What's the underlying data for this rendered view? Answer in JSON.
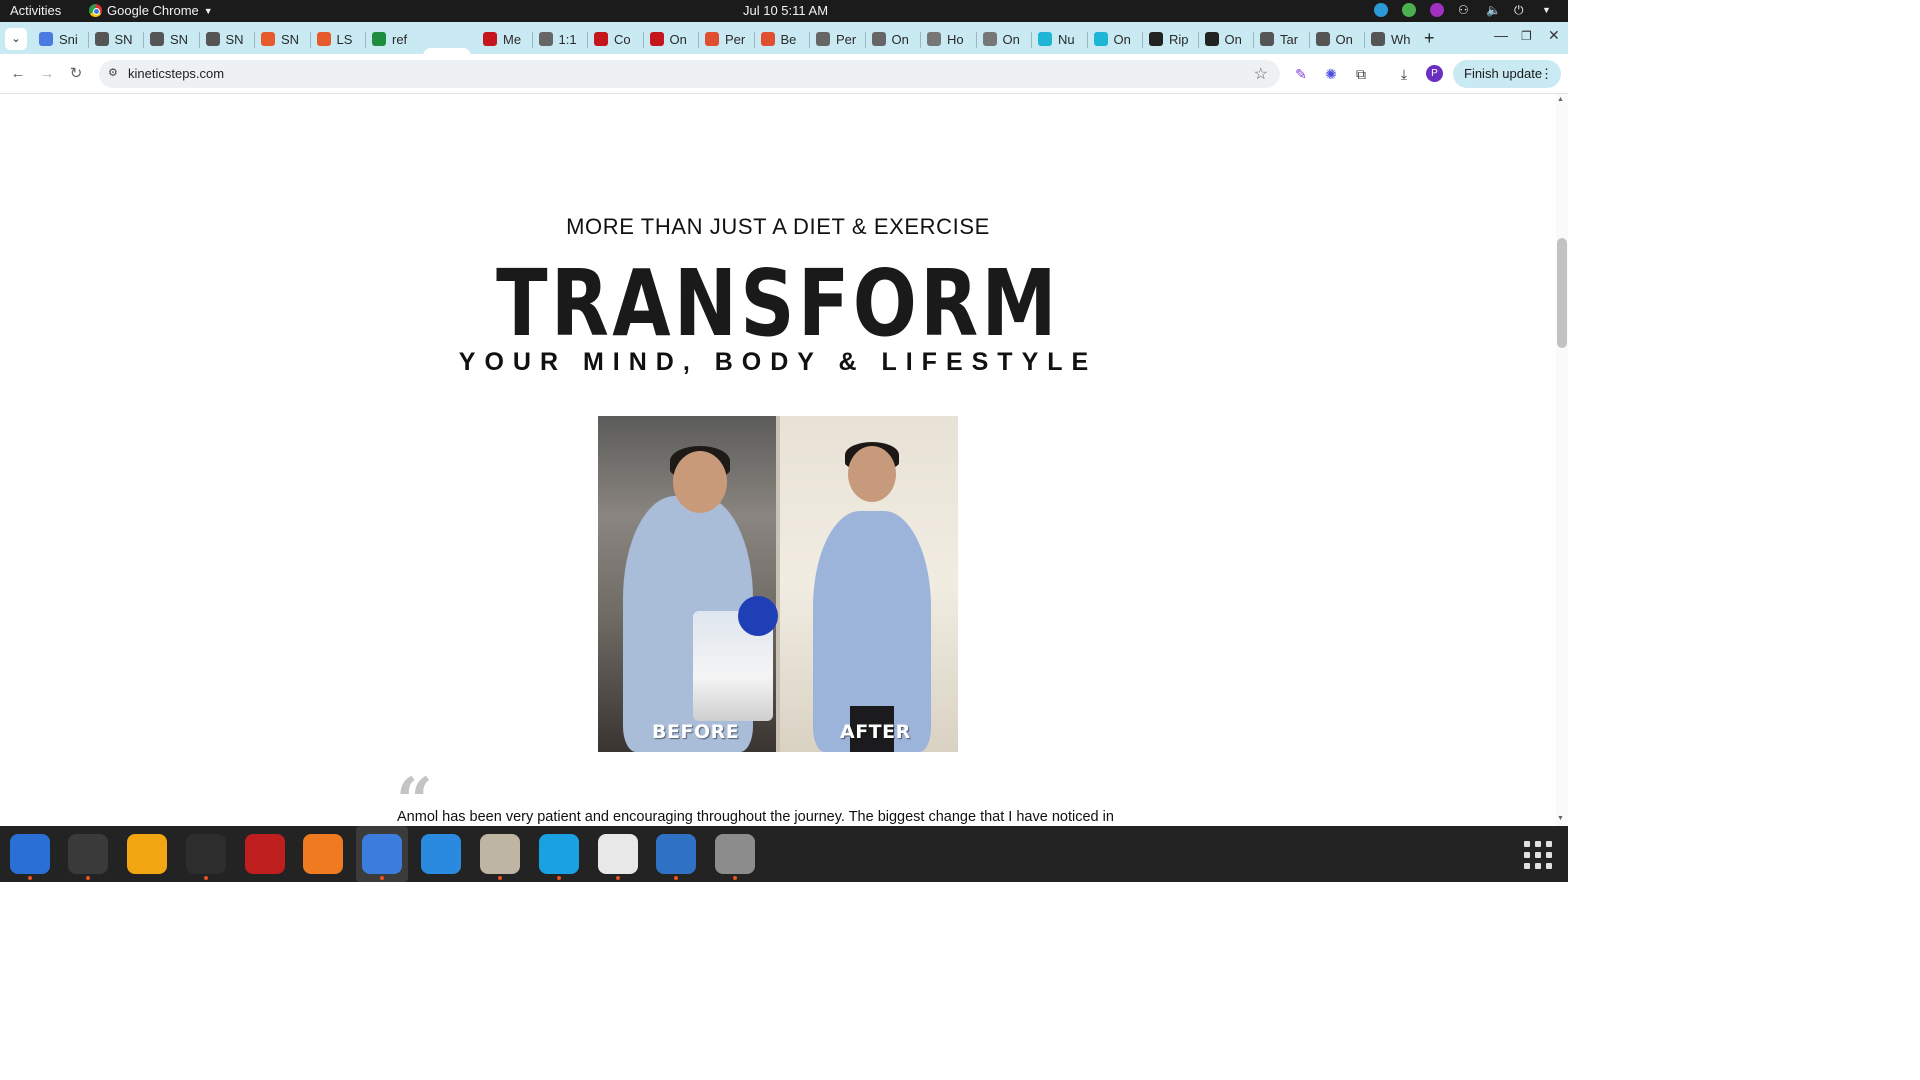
{
  "topbar": {
    "activities": "Activities",
    "app_name": "Google Chrome",
    "clock": "Jul 10  5:11 AM"
  },
  "tabs": [
    {
      "label": "Sni",
      "fav_color": "#4a7be0"
    },
    {
      "label": "SN",
      "fav_color": "#555555"
    },
    {
      "label": "SN",
      "fav_color": "#555555"
    },
    {
      "label": "SN",
      "fav_color": "#555555"
    },
    {
      "label": "SN",
      "fav_color": "#e65a2b"
    },
    {
      "label": "LS",
      "fav_color": "#e65a2b"
    },
    {
      "label": "ref",
      "fav_color": "#1e8e3e"
    },
    {
      "label": "",
      "fav_color": "#c4161c",
      "active": true
    },
    {
      "label": "Me",
      "fav_color": "#c4161c"
    },
    {
      "label": "1:1",
      "fav_color": "#666666"
    },
    {
      "label": "Co",
      "fav_color": "#c4161c"
    },
    {
      "label": "On",
      "fav_color": "#c4161c"
    },
    {
      "label": "Per",
      "fav_color": "#e05030"
    },
    {
      "label": "Be",
      "fav_color": "#e05030"
    },
    {
      "label": "Per",
      "fav_color": "#666666"
    },
    {
      "label": "On",
      "fav_color": "#666666"
    },
    {
      "label": "Ho",
      "fav_color": "#777777"
    },
    {
      "label": "On",
      "fav_color": "#777777"
    },
    {
      "label": "Nu",
      "fav_color": "#1fb5d6"
    },
    {
      "label": "On",
      "fav_color": "#1fb5d6"
    },
    {
      "label": "Rip",
      "fav_color": "#222222"
    },
    {
      "label": "On",
      "fav_color": "#222222"
    },
    {
      "label": "Tar",
      "fav_color": "#555555"
    },
    {
      "label": "On",
      "fav_color": "#555555"
    },
    {
      "label": "Wh",
      "fav_color": "#555555"
    }
  ],
  "toolbar": {
    "url": "kineticsteps.com",
    "avatar_letter": "P",
    "finish_update": "Finish update"
  },
  "page": {
    "kicker": "MORE THAN JUST A DIET & EXERCISE",
    "hero": "TRANSFORM",
    "subhero": "YOUR MIND, BODY & LIFESTYLE",
    "photo_before": "BEFORE",
    "photo_after": "AFTER",
    "quote_mark": "“",
    "testimonial": "Anmol has been very patient and encouraging throughout the journey. The biggest change that I have noticed in"
  },
  "dock": [
    {
      "name": "thunderbird",
      "color": "#2a6fd6",
      "running": true
    },
    {
      "name": "terminal",
      "color": "#3a3a3a",
      "running": true
    },
    {
      "name": "calculator",
      "color": "#f2a612",
      "running": false
    },
    {
      "name": "system-monitor",
      "color": "#2d2d2d",
      "running": true
    },
    {
      "name": "filezilla",
      "color": "#bf1e1e",
      "running": false
    },
    {
      "name": "firefox",
      "color": "#f07a20",
      "running": false
    },
    {
      "name": "chrome",
      "color": "#3b7ddd",
      "running": true
    },
    {
      "name": "vscode",
      "color": "#2a8adf",
      "running": false
    },
    {
      "name": "files",
      "color": "#bfb5a3",
      "running": true
    },
    {
      "name": "skype",
      "color": "#1aa1e1",
      "running": true
    },
    {
      "name": "text-editor",
      "color": "#e8e8e8",
      "running": true
    },
    {
      "name": "libreoffice-writer",
      "color": "#2f71c4",
      "running": true
    },
    {
      "name": "disk",
      "color": "#8c8c8c",
      "running": true
    }
  ]
}
